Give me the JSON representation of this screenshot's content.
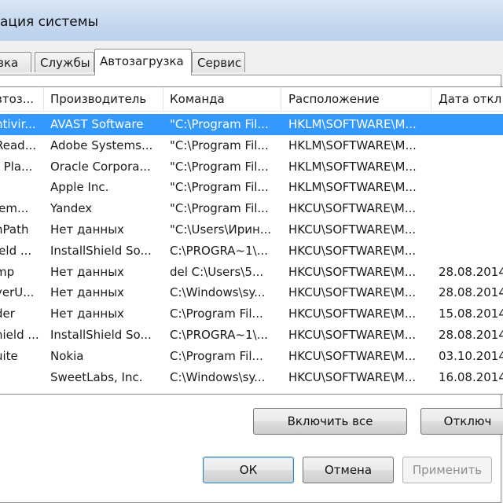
{
  "window": {
    "title": "ация системы"
  },
  "tabs": [
    {
      "label": "зка",
      "active": false
    },
    {
      "label": "Службы",
      "active": false
    },
    {
      "label": "Автозагрузка",
      "active": true
    },
    {
      "label": "Сервис",
      "active": false
    }
  ],
  "table": {
    "columns": [
      "втоз...",
      "Производитель",
      "Команда",
      "Расположение",
      "Дата откл"
    ],
    "rows": [
      [
        "ntivir...",
        "AVAST Software",
        "\"C:\\Program Fil...",
        "HKLM\\SOFTWARE\\M...",
        ""
      ],
      [
        "Read...",
        "Adobe Systems...",
        "\"C:\\Program Fil...",
        "HKLM\\SOFTWARE\\M...",
        ""
      ],
      [
        ") Pla...",
        "Oracle Corpora...",
        "\"C:\\Program Fil...",
        "HKLM\\SOFTWARE\\M...",
        ""
      ],
      [
        "",
        "Apple Inc.",
        "\"C:\\Program Fil...",
        "HKLM\\SOFTWARE\\M...",
        ""
      ],
      [
        "lem...",
        "Yandex",
        "\"C:\\Program Fil...",
        "HKCU\\SOFTWARE\\M...",
        ""
      ],
      [
        "nPath",
        "Нет данных",
        "\"C:\\Users\\Ирин...",
        "HKCU\\SOFTWARE\\M...",
        ""
      ],
      [
        "ield ...",
        "InstallShield So...",
        "C:\\PROGRA~1\\...",
        "HKCU\\SOFTWARE\\M...",
        ""
      ],
      [
        "mp",
        "Нет данных",
        "del C:\\Users\\5...",
        "HKCU\\SOFTWARE\\M...",
        "28.08.2014"
      ],
      [
        "yerU...",
        "Нет данных",
        "C:\\Windows\\sy...",
        "HKCU\\SOFTWARE\\M...",
        "28.08.2014"
      ],
      [
        "der",
        "Нет данных",
        "C:\\Program Fil...",
        "HKCU\\SOFTWARE\\M...",
        "15.08.2014"
      ],
      [
        "hield ...",
        "InstallShield So...",
        "C:\\PROGRA~1\\...",
        "HKCU\\SOFTWARE\\M...",
        "28.08.2014"
      ],
      [
        "uite",
        "Nokia",
        "C:\\Program Fil...",
        "HKCU\\SOFTWARE\\M...",
        "03.10.2014"
      ],
      [
        "",
        "SweetLabs, Inc.",
        "C:\\Windows\\sy...",
        "HKCU\\SOFTWARE\\M...",
        "16.08.2014"
      ]
    ]
  },
  "panel_buttons": {
    "enable_all": "Включить все",
    "disable_all": "Отключ"
  },
  "dialog_buttons": {
    "ok": "ОК",
    "cancel": "Отмена",
    "apply": "Применить"
  }
}
